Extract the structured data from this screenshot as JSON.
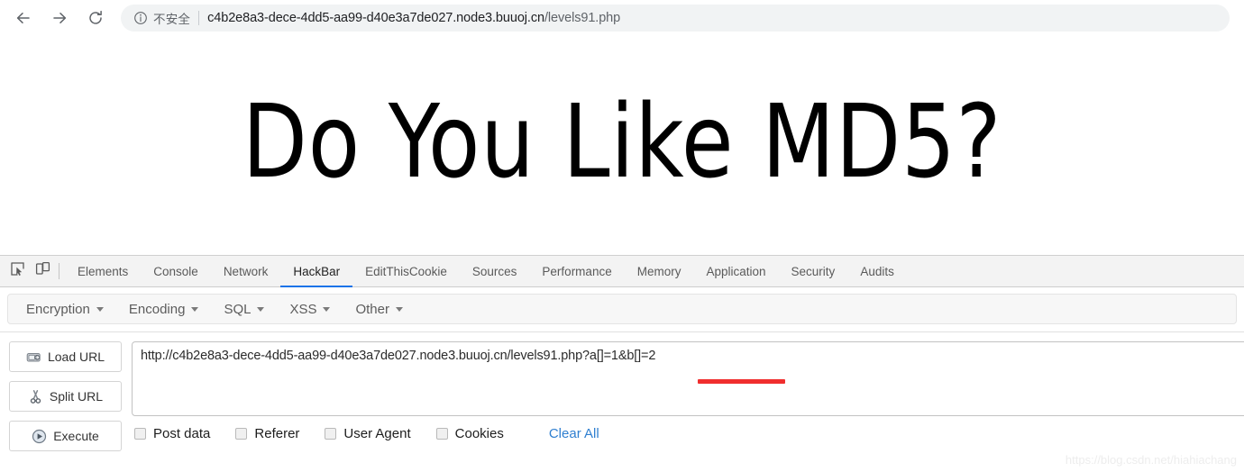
{
  "browser": {
    "nav": {
      "back_icon": "arrow-left-icon",
      "forward_icon": "arrow-right-icon",
      "reload_icon": "reload-icon"
    },
    "omnibox": {
      "security_icon": "info-circle-icon",
      "security_label": "不安全",
      "url_host": "c4b2e8a3-dece-4dd5-aa99-d40e3a7de027.node3.buuoj.cn",
      "url_path": "/levels91.php"
    }
  },
  "page": {
    "heading": "Do You Like MD5?"
  },
  "devtools": {
    "icons": {
      "inspect": "inspect-element-icon",
      "device": "device-toolbar-icon"
    },
    "tabs": [
      {
        "label": "Elements",
        "active": false
      },
      {
        "label": "Console",
        "active": false
      },
      {
        "label": "Network",
        "active": false
      },
      {
        "label": "HackBar",
        "active": true
      },
      {
        "label": "EditThisCookie",
        "active": false
      },
      {
        "label": "Sources",
        "active": false
      },
      {
        "label": "Performance",
        "active": false
      },
      {
        "label": "Memory",
        "active": false
      },
      {
        "label": "Application",
        "active": false
      },
      {
        "label": "Security",
        "active": false
      },
      {
        "label": "Audits",
        "active": false
      }
    ]
  },
  "hackbar": {
    "menus": [
      {
        "label": "Encryption"
      },
      {
        "label": "Encoding"
      },
      {
        "label": "SQL"
      },
      {
        "label": "XSS"
      },
      {
        "label": "Other"
      }
    ],
    "buttons": [
      {
        "label": "Load URL",
        "icon": "load-url-icon"
      },
      {
        "label": "Split URL",
        "icon": "scissors-icon"
      },
      {
        "label": "Execute",
        "icon": "play-icon"
      }
    ],
    "url_value": "http://c4b2e8a3-dece-4dd5-aa99-d40e3a7de027.node3.buuoj.cn/levels91.php?a[]=1&b[]=2",
    "url_placeholder": "",
    "annotation_color": "#f02e2e",
    "checkboxes": [
      {
        "label": "Post data",
        "checked": false
      },
      {
        "label": "Referer",
        "checked": false
      },
      {
        "label": "User Agent",
        "checked": false
      },
      {
        "label": "Cookies",
        "checked": false
      }
    ],
    "clear_all_label": "Clear All",
    "link_color": "#2f7fd0"
  },
  "watermark": {
    "text": "https://blog.csdn.net/hiahiachang"
  }
}
